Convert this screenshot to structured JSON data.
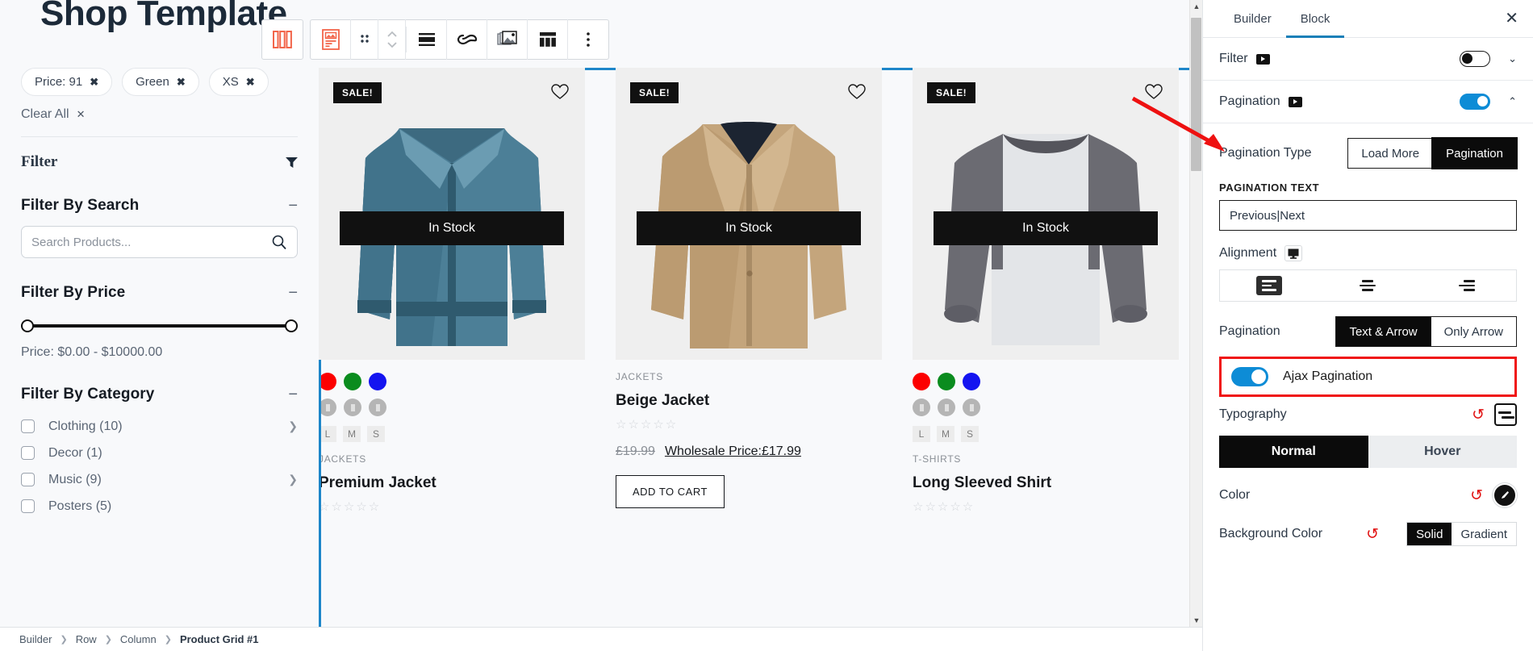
{
  "shop": {
    "title": "Shop Template",
    "chips": [
      {
        "label": "Price: 91",
        "close": "✖"
      },
      {
        "label": "Green",
        "close": "✖"
      },
      {
        "label": "XS",
        "close": "✖"
      }
    ],
    "clear_all": "Clear All",
    "clear_all_x": "✕",
    "filter_heading": "Filter",
    "sections": {
      "search": {
        "title": "Filter By Search",
        "collapse": "−",
        "placeholder": "Search Products..."
      },
      "price": {
        "title": "Filter By Price",
        "collapse": "−",
        "range_label": "Price: $0.00 - $10000.00"
      },
      "category": {
        "title": "Filter By Category",
        "collapse": "−"
      }
    },
    "categories": [
      {
        "label": "Clothing (10)",
        "has_children": true
      },
      {
        "label": "Decor (1)",
        "has_children": false
      },
      {
        "label": "Music (9)",
        "has_children": true
      },
      {
        "label": "Posters (5)",
        "has_children": false
      }
    ]
  },
  "toolbar": {
    "items": [
      {
        "name": "columns-icon"
      },
      {
        "name": "product-block-icon"
      },
      {
        "name": "drag-handle-icon"
      },
      {
        "name": "move-updown-icon"
      },
      {
        "name": "align-icon"
      },
      {
        "name": "link-icon"
      },
      {
        "name": "gallery-icon"
      },
      {
        "name": "layout-icon"
      },
      {
        "name": "more-options-icon"
      }
    ]
  },
  "products": [
    {
      "sale_badge": "SALE!",
      "stock_label": "In Stock",
      "swatches": [
        "#fc0000",
        "#0a8c1e",
        "#1414f0"
      ],
      "sizes": [
        "L",
        "M",
        "S"
      ],
      "category": "JACKETS",
      "name": "Premium Jacket",
      "stars": "☆☆☆☆☆",
      "old_price": "",
      "wholesale": "",
      "add_to_cart": ""
    },
    {
      "sale_badge": "SALE!",
      "stock_label": "In Stock",
      "swatches": [],
      "sizes": [],
      "category": "JACKETS",
      "name": "Beige Jacket",
      "stars": "☆☆☆☆☆",
      "old_price": "£19.99",
      "wholesale": "Wholesale Price:£17.99",
      "add_to_cart": "ADD TO CART"
    },
    {
      "sale_badge": "SALE!",
      "stock_label": "In Stock",
      "swatches": [
        "#fc0000",
        "#0a8c1e",
        "#1414f0"
      ],
      "sizes": [
        "L",
        "M",
        "S"
      ],
      "category": "T-SHIRTS",
      "name": "Long Sleeved Shirt",
      "stars": "☆☆☆☆☆",
      "old_price": "",
      "wholesale": "",
      "add_to_cart": ""
    }
  ],
  "breadcrumb": {
    "items": [
      "Builder",
      "Row",
      "Column",
      "Product Grid #1"
    ],
    "separator": "❯"
  },
  "panel": {
    "tabs": [
      {
        "label": "Builder",
        "active": false
      },
      {
        "label": "Block",
        "active": true
      }
    ],
    "close": "✕",
    "rows": {
      "filter": {
        "label": "Filter",
        "toggle_on": false,
        "chevron": "⌄"
      },
      "pagination": {
        "label": "Pagination",
        "toggle_on": true,
        "chevron": "⌃"
      }
    },
    "pagination_type": {
      "label": "Pagination Type",
      "options": [
        {
          "label": "Load More",
          "selected": false
        },
        {
          "label": "Pagination",
          "selected": true
        }
      ]
    },
    "pagination_text": {
      "label": "PAGINATION TEXT",
      "value": "Previous|Next"
    },
    "alignment": {
      "label": "Alignment",
      "device_icon": "monitor-icon",
      "options": [
        {
          "name": "align-left",
          "selected": true
        },
        {
          "name": "align-center",
          "selected": false
        },
        {
          "name": "align-right",
          "selected": false
        }
      ]
    },
    "pagination_style": {
      "label": "Pagination",
      "options": [
        {
          "label": "Text & Arrow",
          "selected": true
        },
        {
          "label": "Only Arrow",
          "selected": false
        }
      ]
    },
    "ajax_pagination": {
      "label": "Ajax Pagination",
      "toggle_on": true
    },
    "typography": {
      "label": "Typography",
      "reset": "↺"
    },
    "normal_hover": {
      "options": [
        {
          "label": "Normal",
          "selected": true
        },
        {
          "label": "Hover",
          "selected": false
        }
      ]
    },
    "color": {
      "label": "Color",
      "reset": "↺"
    },
    "background_color": {
      "label": "Background Color",
      "reset": "↺",
      "options": [
        {
          "label": "Solid",
          "selected": true
        },
        {
          "label": "Gradient",
          "selected": false
        }
      ]
    }
  },
  "colors": {
    "accent_blue": "#0d8cd6",
    "tab_underline": "#1b7fb8",
    "highlight_red": "#f01414",
    "selection_blue": "#1d86c9"
  }
}
